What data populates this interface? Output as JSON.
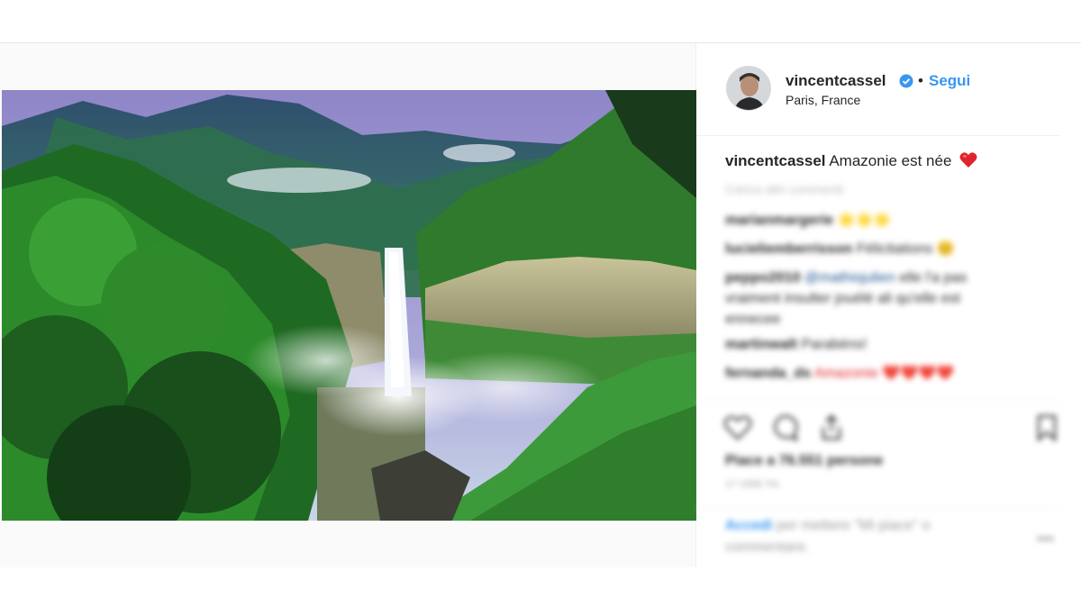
{
  "post": {
    "username": "vincentcassel",
    "follow_label": "Segui",
    "separator": "•",
    "location": "Paris, France",
    "caption_user": "vincentcassel",
    "caption_text": "Amazonie est née",
    "caption_emoji": "❤️"
  },
  "comments": {
    "load_more": "Carica altri commenti",
    "items": [
      {
        "user": "marianmargerie",
        "text": "🌟🌟🌟"
      },
      {
        "user": "lucieliemberrisson",
        "text": "Félicitations 😊"
      },
      {
        "user": "peppo2010",
        "mention": "@mathisjulien",
        "text": "elle l'a pas vraiment insulter jouélé ali qu'elle est ennecee"
      },
      {
        "user": "martinwalt",
        "text": "Parabéns!"
      },
      {
        "user": "fernanda_ds",
        "text": "Amazonie ❤️❤️❤️❤️"
      }
    ]
  },
  "actions": {
    "like_icon": "heart-outline-icon",
    "comment_icon": "comment-icon",
    "share_icon": "share-icon",
    "save_icon": "bookmark-icon"
  },
  "likes_text": "Piace a 76.551 persone",
  "timestamp": "17 ORE FA",
  "login_prompt": {
    "link": "Accedi",
    "text": "per mettere \"Mi piace\" o commentare."
  },
  "more_label": "•••",
  "colors": {
    "accent": "#3897f0",
    "heart": "#ed4956",
    "verified": "#3897f0"
  }
}
